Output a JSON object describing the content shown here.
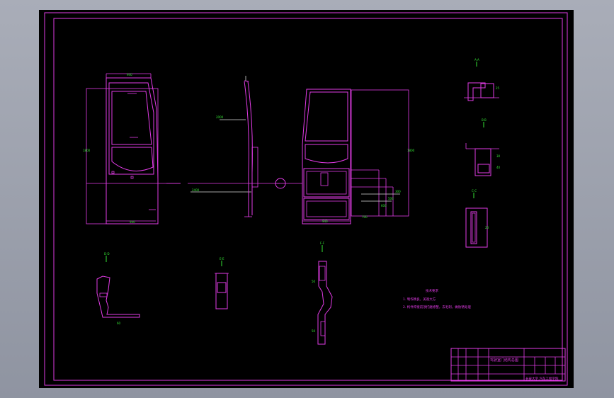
{
  "drawing": {
    "notes": {
      "heading": "技术要求",
      "line1": "1. 制作精良，美观大方",
      "line2": "2. 构件焊接前须打磨修整，去毛刺，做防锈处理"
    },
    "title_block": {
      "drawing_title": "驾驶室门结构总图",
      "school": "长安大学 汽车工程学院"
    }
  },
  "colors": {
    "background": "#000000",
    "linework": "#e23be6",
    "dimensions": "#34e534",
    "callouts": "#d8d8d8"
  }
}
